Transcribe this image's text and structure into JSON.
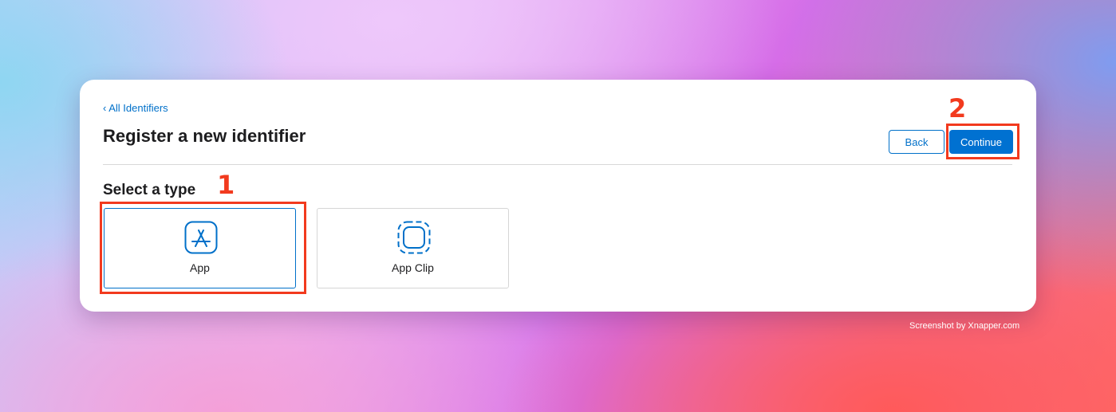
{
  "nav": {
    "back_link": "‹ All Identifiers"
  },
  "header": {
    "title": "Register a new identifier"
  },
  "actions": {
    "back_label": "Back",
    "continue_label": "Continue"
  },
  "section": {
    "title": "Select a type"
  },
  "types": [
    {
      "label": "App",
      "icon": "app-store-icon",
      "selected": true
    },
    {
      "label": "App Clip",
      "icon": "app-clip-icon",
      "selected": false
    }
  ],
  "annotations": [
    {
      "number": "1",
      "target": "App"
    },
    {
      "number": "2",
      "target": "Continue"
    }
  ],
  "credit": "Screenshot by Xnapper.com",
  "colors": {
    "accent": "#0070c9",
    "annotation": "#f23a1e"
  }
}
